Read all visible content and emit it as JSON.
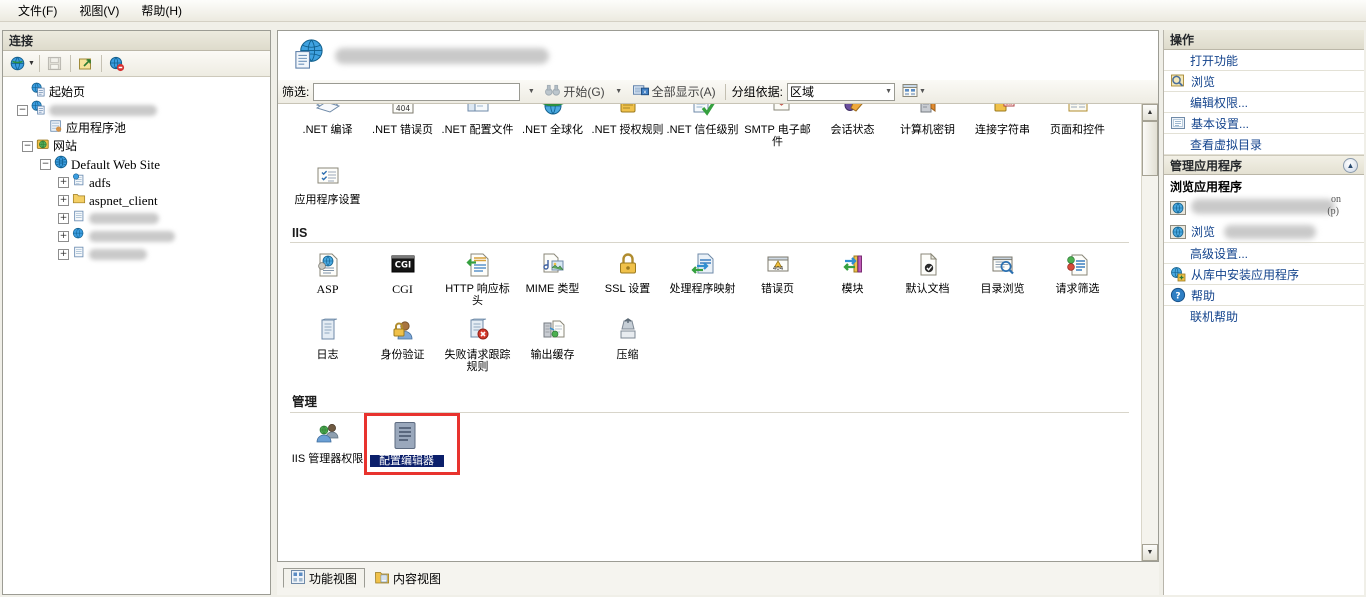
{
  "menubar": {
    "items": [
      {
        "label": "文件(F)",
        "name": "menu-file"
      },
      {
        "label": "视图(V)",
        "name": "menu-view"
      },
      {
        "label": "帮助(H)",
        "name": "menu-help"
      }
    ]
  },
  "connections": {
    "title": "连接",
    "toolbar": {
      "connect_tasks": "connect-tasks-icon",
      "save_icon": "save-icon",
      "connect_server_icon": "connect-to-server-icon",
      "disconnect_icon": "disconnect-icon"
    },
    "tree": [
      {
        "label": "起始页",
        "indent": 0,
        "expander": "",
        "icon": "start-page-icon",
        "blurred": false
      },
      {
        "label": "",
        "indent": 0,
        "expander": "-",
        "icon": "server-icon",
        "blurred": true,
        "blur_width": 108
      },
      {
        "label": "应用程序池",
        "indent": 1,
        "expander": "",
        "icon": "app-pools-icon",
        "blurred": false
      },
      {
        "label": "网站",
        "indent": 1,
        "expander": "-",
        "icon": "sites-folder-icon",
        "blurred": false
      },
      {
        "label": "Default Web Site",
        "indent": 2,
        "expander": "-",
        "icon": "website-icon",
        "blurred": false,
        "serif": true
      },
      {
        "label": "adfs",
        "indent": 3,
        "expander": "+",
        "icon": "application-icon",
        "blurred": false,
        "serif": true
      },
      {
        "label": "aspnet_client",
        "indent": 3,
        "expander": "+",
        "icon": "folder-icon",
        "blurred": false,
        "serif": true
      },
      {
        "label": "",
        "indent": 3,
        "expander": "+",
        "icon": "application-icon",
        "blurred": true,
        "blur_width": 70
      },
      {
        "label": "",
        "indent": 3,
        "expander": "+",
        "icon": "website-icon",
        "blurred": true,
        "blur_width": 86
      },
      {
        "label": "",
        "indent": 3,
        "expander": "+",
        "icon": "application-icon",
        "blurred": true,
        "blur_width": 58
      }
    ]
  },
  "main": {
    "page_title_blurred": true,
    "page_title_icon": "application-page-icon",
    "filter": {
      "label": "筛选:",
      "value": "",
      "placeholder": "",
      "go_label": "开始(G)",
      "show_all_label": "全部显示(A)",
      "group_by_label": "分组依据:",
      "group_by_value": "区域",
      "view_mode_icon": "view-details-icon"
    },
    "sections": [
      {
        "name": "ASP.NET",
        "header_visible": false,
        "clipped_top": true,
        "items": [
          {
            "label": ".NET 编译",
            "icon": "net-compilation-icon"
          },
          {
            "label": ".NET 错误页",
            "icon": "net-error-pages-icon"
          },
          {
            "label": ".NET 配置文件",
            "icon": "net-profile-icon"
          },
          {
            "label": ".NET 全球化",
            "icon": "net-globalization-icon"
          },
          {
            "label": ".NET 授权规则",
            "icon": "net-authorization-icon"
          },
          {
            "label": ".NET 信任级别",
            "icon": "net-trust-levels-icon"
          },
          {
            "label": "SMTP 电子邮件",
            "icon": "smtp-email-icon"
          },
          {
            "label": "会话状态",
            "icon": "session-state-icon"
          },
          {
            "label": "计算机密钥",
            "icon": "machine-key-icon"
          },
          {
            "label": "连接字符串",
            "icon": "connection-strings-icon"
          },
          {
            "label": "页面和控件",
            "icon": "pages-controls-icon"
          }
        ]
      },
      {
        "name": "ASP.NET-row2",
        "header_visible": false,
        "items": [
          {
            "label": "应用程序设置",
            "icon": "application-settings-icon"
          }
        ]
      },
      {
        "name": "IIS",
        "header_visible": true,
        "items": [
          {
            "label": "ASP",
            "icon": "asp-icon",
            "serif": true
          },
          {
            "label": "CGI",
            "icon": "cgi-icon",
            "serif": true
          },
          {
            "label": "HTTP 响应标头",
            "icon": "http-response-headers-icon"
          },
          {
            "label": "MIME 类型",
            "icon": "mime-types-icon"
          },
          {
            "label": "SSL 设置",
            "icon": "ssl-settings-icon"
          },
          {
            "label": "处理程序映射",
            "icon": "handler-mappings-icon"
          },
          {
            "label": "错误页",
            "icon": "error-pages-icon"
          },
          {
            "label": "模块",
            "icon": "modules-icon"
          },
          {
            "label": "默认文档",
            "icon": "default-document-icon"
          },
          {
            "label": "目录浏览",
            "icon": "directory-browsing-icon"
          },
          {
            "label": "请求筛选",
            "icon": "request-filtering-icon"
          },
          {
            "label": "日志",
            "icon": "logging-icon"
          },
          {
            "label": "身份验证",
            "icon": "authentication-icon"
          },
          {
            "label": "失败请求跟踪规则",
            "icon": "failed-request-tracing-icon"
          },
          {
            "label": "输出缓存",
            "icon": "output-caching-icon"
          },
          {
            "label": "压缩",
            "icon": "compression-icon"
          }
        ]
      },
      {
        "name": "管理",
        "header_visible": true,
        "items": [
          {
            "label": "IIS 管理器权限",
            "icon": "iis-manager-permissions-icon"
          },
          {
            "label": "配置编辑器",
            "icon": "configuration-editor-icon",
            "selected": true,
            "highlighted": true
          }
        ]
      }
    ],
    "view_tabs": [
      {
        "label": "功能视图",
        "icon": "features-view-icon",
        "active": true
      },
      {
        "label": "内容视图",
        "icon": "content-view-icon",
        "active": false
      }
    ]
  },
  "actions": {
    "title": "操作",
    "items": [
      {
        "label": "打开功能",
        "icon": "",
        "name": "action-open-feature"
      },
      {
        "label": "浏览",
        "icon": "browse-icon",
        "name": "action-browse"
      },
      {
        "label": "编辑权限...",
        "icon": "",
        "name": "action-edit-permissions"
      },
      {
        "label": "基本设置...",
        "icon": "basic-settings-icon",
        "name": "action-basic-settings"
      },
      {
        "label": "查看虚拟目录",
        "icon": "",
        "name": "action-view-virtual-directories"
      }
    ],
    "group_manage_app": {
      "title": "管理应用程序",
      "collapse_icon": "chevron-up-icon",
      "subtitle": "浏览应用程序",
      "browse_items": [
        {
          "label": "",
          "icon": "browse-globe-icon",
          "blurred": true,
          "suffix": "on",
          "suffix2": "(p)"
        },
        {
          "label": "浏览",
          "icon": "browse-globe-icon",
          "blurred": true
        }
      ],
      "items": [
        {
          "label": "高级设置...",
          "icon": "",
          "name": "action-advanced-settings"
        },
        {
          "label": "从库中安装应用程序",
          "icon": "install-from-gallery-icon",
          "name": "action-install-from-gallery"
        },
        {
          "label": "帮助",
          "icon": "help-icon",
          "name": "action-help"
        },
        {
          "label": "联机帮助",
          "icon": "",
          "name": "action-online-help"
        }
      ]
    }
  },
  "colors": {
    "annotation_red": "#e8332e",
    "selection_navy": "#0b1f6b",
    "link_blue": "#13438c"
  }
}
